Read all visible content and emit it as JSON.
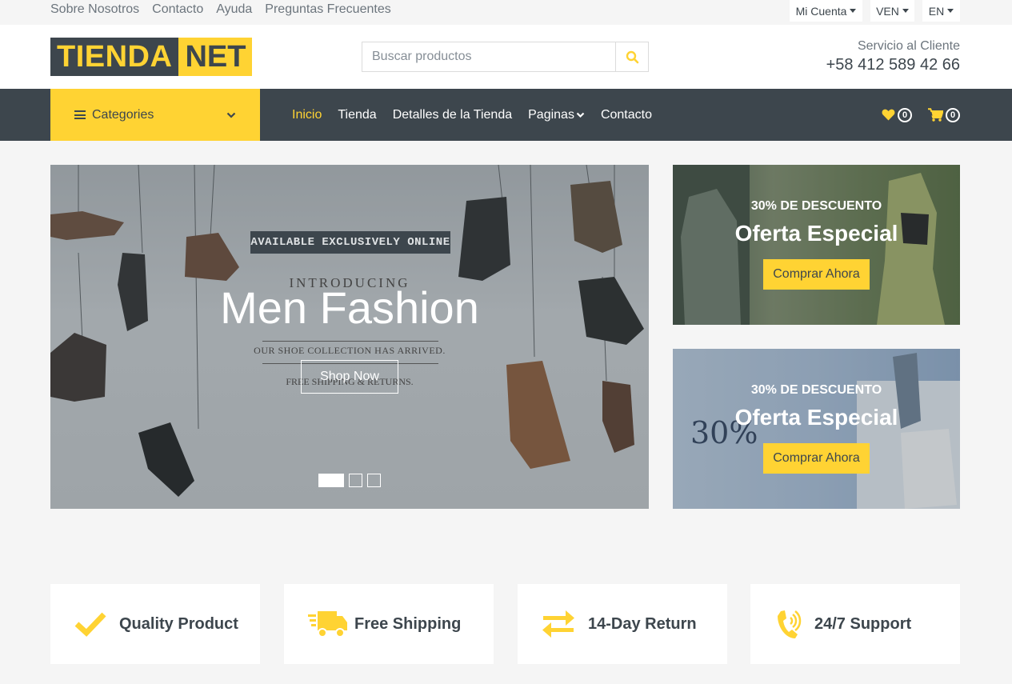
{
  "topbar": {
    "links": [
      "Sobre Nosotros",
      "Contacto",
      "Ayuda",
      "Preguntas Frecuentes"
    ],
    "account": "Mi Cuenta",
    "currency": "VEN",
    "language": "EN"
  },
  "header": {
    "logo_a": "TIENDA",
    "logo_b": "NET",
    "search_placeholder": "Buscar productos",
    "service_label": "Servicio al Cliente",
    "phone": "+58 412 589 42 66"
  },
  "nav": {
    "categories": "Categories",
    "items": [
      "Inicio",
      "Tienda",
      "Detalles de la Tienda",
      "Paginas",
      "Contacto"
    ],
    "wishlist_count": "0",
    "cart_count": "0"
  },
  "carousel": {
    "ribbon": "AVAILABLE EXCLUSIVELY ONLINE",
    "introducing": "INTRODUCING",
    "title": "Men Fashion",
    "collection": "OUR SHOE COLLECTION HAS ARRIVED.",
    "free": "FREE SHIPPING & RETURNS.",
    "button": "Shop Now"
  },
  "offers": [
    {
      "discount": "30% DE DESCUENTO",
      "title": "Oferta Especial",
      "button": "Comprar Ahora"
    },
    {
      "discount": "30% DE DESCUENTO",
      "title": "Oferta Especial",
      "button": "Comprar Ahora"
    }
  ],
  "features": [
    "Quality Product",
    "Free Shipping",
    "14-Day Return",
    "24/7 Support"
  ],
  "colors": {
    "accent": "#ffd333",
    "dark": "#3d464d"
  }
}
